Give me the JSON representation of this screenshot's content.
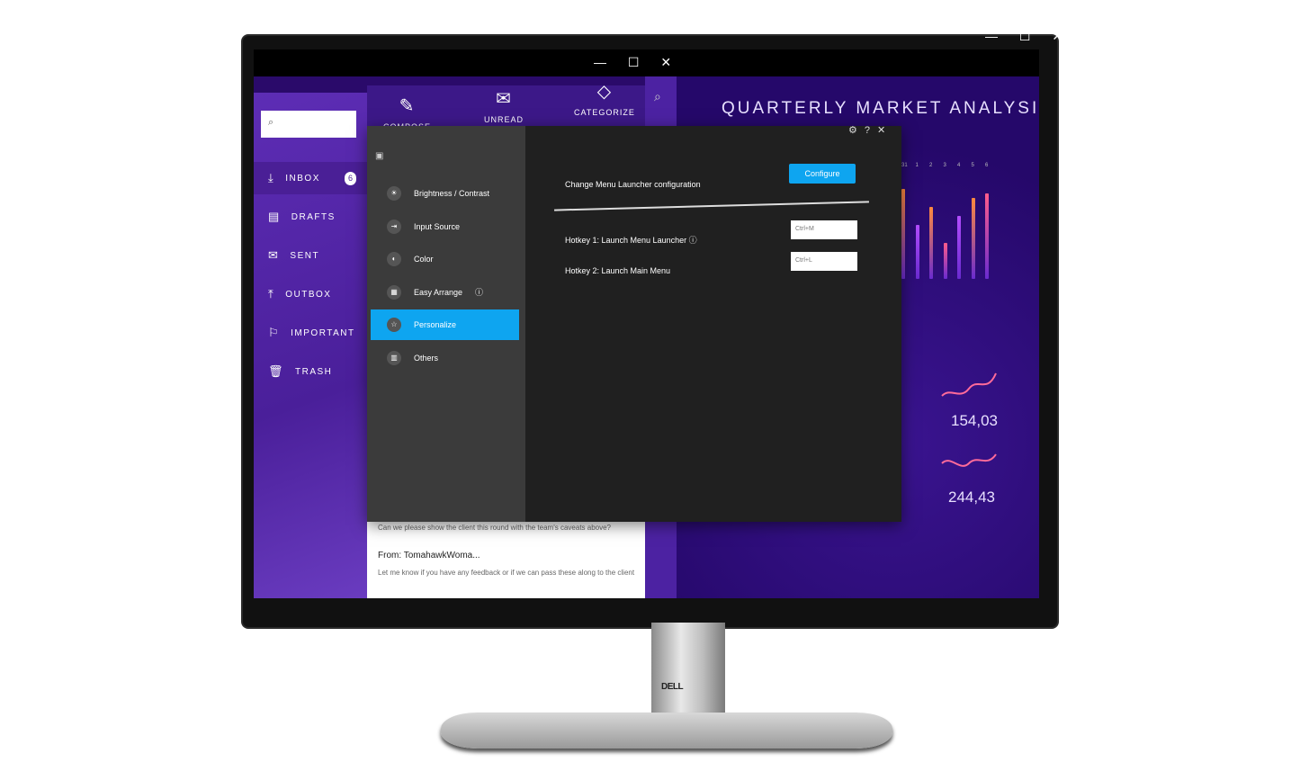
{
  "window_controls": "— ☐ ✕",
  "sidebar": {
    "search_placeholder": "",
    "items": [
      {
        "label": "INBOX",
        "icon": "inbox-icon",
        "badge": "6"
      },
      {
        "label": "DRAFTS",
        "icon": "drafts-icon"
      },
      {
        "label": "SENT",
        "icon": "sent-icon"
      },
      {
        "label": "OUTBOX",
        "icon": "outbox-icon"
      },
      {
        "label": "IMPORTANT",
        "icon": "flag-icon"
      },
      {
        "label": "TRASH",
        "icon": "trash-icon"
      }
    ]
  },
  "toolbar": {
    "compose": "COMPOSE",
    "unread": "UNREAD",
    "categorize": "CATEGORIZE"
  },
  "mail": {
    "preview1": "Can we please show the client this round with the team's caveats above?",
    "from": "From: TomahawkWoma...",
    "preview2": "Let me know if you have any feedback or if we can pass these along to the client"
  },
  "dashboard": {
    "title": "QUARTERLY MARKET ANALYSIS",
    "days": [
      "31",
      "1",
      "2",
      "3",
      "4",
      "5",
      "6"
    ],
    "value1": "154,03",
    "value2": "244,43"
  },
  "osd": {
    "nav": [
      {
        "label": "Brightness / Contrast",
        "icon": "brightness-icon"
      },
      {
        "label": "Input Source",
        "icon": "input-source-icon"
      },
      {
        "label": "Color",
        "icon": "color-icon"
      },
      {
        "label": "Easy Arrange",
        "icon": "easy-arrange-icon"
      },
      {
        "label": "Personalize",
        "icon": "star-icon",
        "active": true
      },
      {
        "label": "Others",
        "icon": "others-icon"
      }
    ],
    "change_label": "Change Menu Launcher configuration",
    "configure": "Configure",
    "hotkey1": "Hotkey 1: Launch Menu Launcher",
    "hotkey1_value": "Ctrl+M",
    "hotkey2": "Hotkey 2: Launch Main Menu",
    "hotkey2_value": "Ctrl+L",
    "accent": "#0ea5f0"
  },
  "brand": "DELL"
}
